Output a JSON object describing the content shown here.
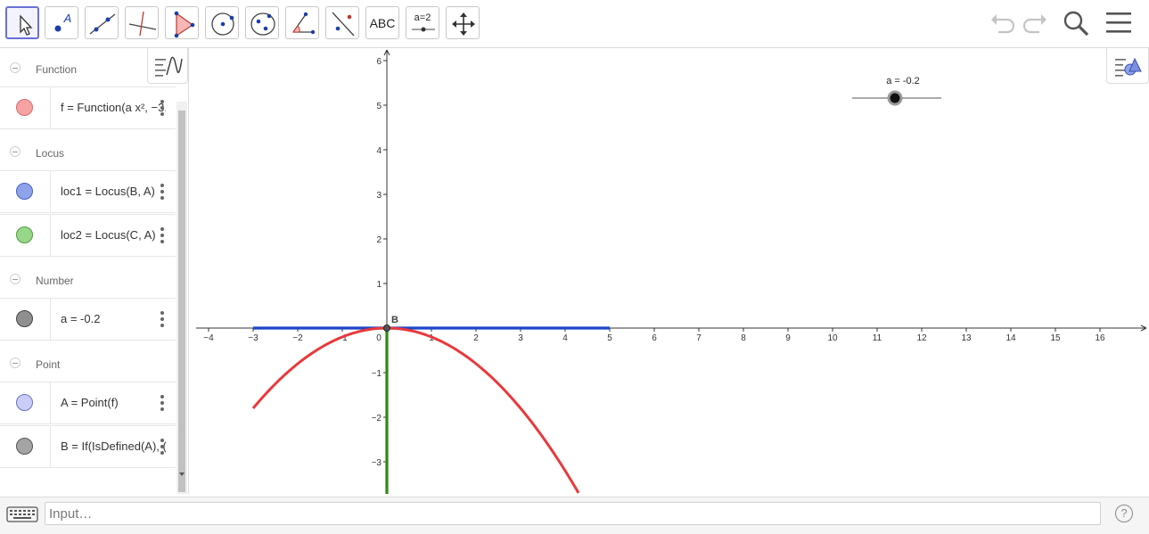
{
  "toolbar": {
    "tools": [
      {
        "name": "move-tool",
        "active": true
      },
      {
        "name": "point-tool",
        "label": "A"
      },
      {
        "name": "line-tool"
      },
      {
        "name": "perpendicular-line-tool"
      },
      {
        "name": "polygon-tool"
      },
      {
        "name": "circle-center-point-tool"
      },
      {
        "name": "conic-ellipse-tool"
      },
      {
        "name": "angle-tool"
      },
      {
        "name": "reflect-tool"
      },
      {
        "name": "text-tool",
        "label": "ABC"
      },
      {
        "name": "slider-tool",
        "label": "a=2"
      },
      {
        "name": "move-graphics-view-tool"
      }
    ],
    "right": [
      "undo-icon",
      "redo-icon",
      "search-icon",
      "menu-icon"
    ]
  },
  "algebra": {
    "groups": [
      {
        "title": "Function",
        "items": [
          {
            "definition": "f = Function(a x², −3,",
            "color": "#f47c7c"
          }
        ]
      },
      {
        "title": "Locus",
        "items": [
          {
            "definition": "loc1 = Locus(B, A)",
            "color": "#8fa3ea"
          },
          {
            "definition": "loc2 = Locus(C, A)",
            "color": "#98d78a"
          }
        ]
      },
      {
        "title": "Number",
        "items": [
          {
            "definition": "a = -0.2",
            "color": "#8f8f8f"
          }
        ]
      },
      {
        "title": "Point",
        "items": [
          {
            "definition": "A = Point(f)",
            "color": "#c9cdf7"
          },
          {
            "definition": "B = If(IsDefined(A), (",
            "color": "#a4a4a4"
          }
        ]
      }
    ]
  },
  "graphics": {
    "x_ticks": [
      "-4",
      "-3",
      "-2",
      "-1",
      "0",
      "1",
      "2",
      "3",
      "4",
      "5",
      "6",
      "7",
      "8",
      "9",
      "10",
      "11",
      "12",
      "13",
      "14",
      "15",
      "16"
    ],
    "y_ticks": [
      "6",
      "5",
      "4",
      "3",
      "2",
      "1",
      "-1",
      "-2",
      "-3"
    ],
    "point_label": "B",
    "slider_label": "a = -0.2",
    "slider_value": -0.2,
    "colors": {
      "function": "#e8393b",
      "locus1": "#1f45c8",
      "locus2": "#2d8a12"
    }
  },
  "input": {
    "placeholder": "Input…",
    "help": "?"
  }
}
